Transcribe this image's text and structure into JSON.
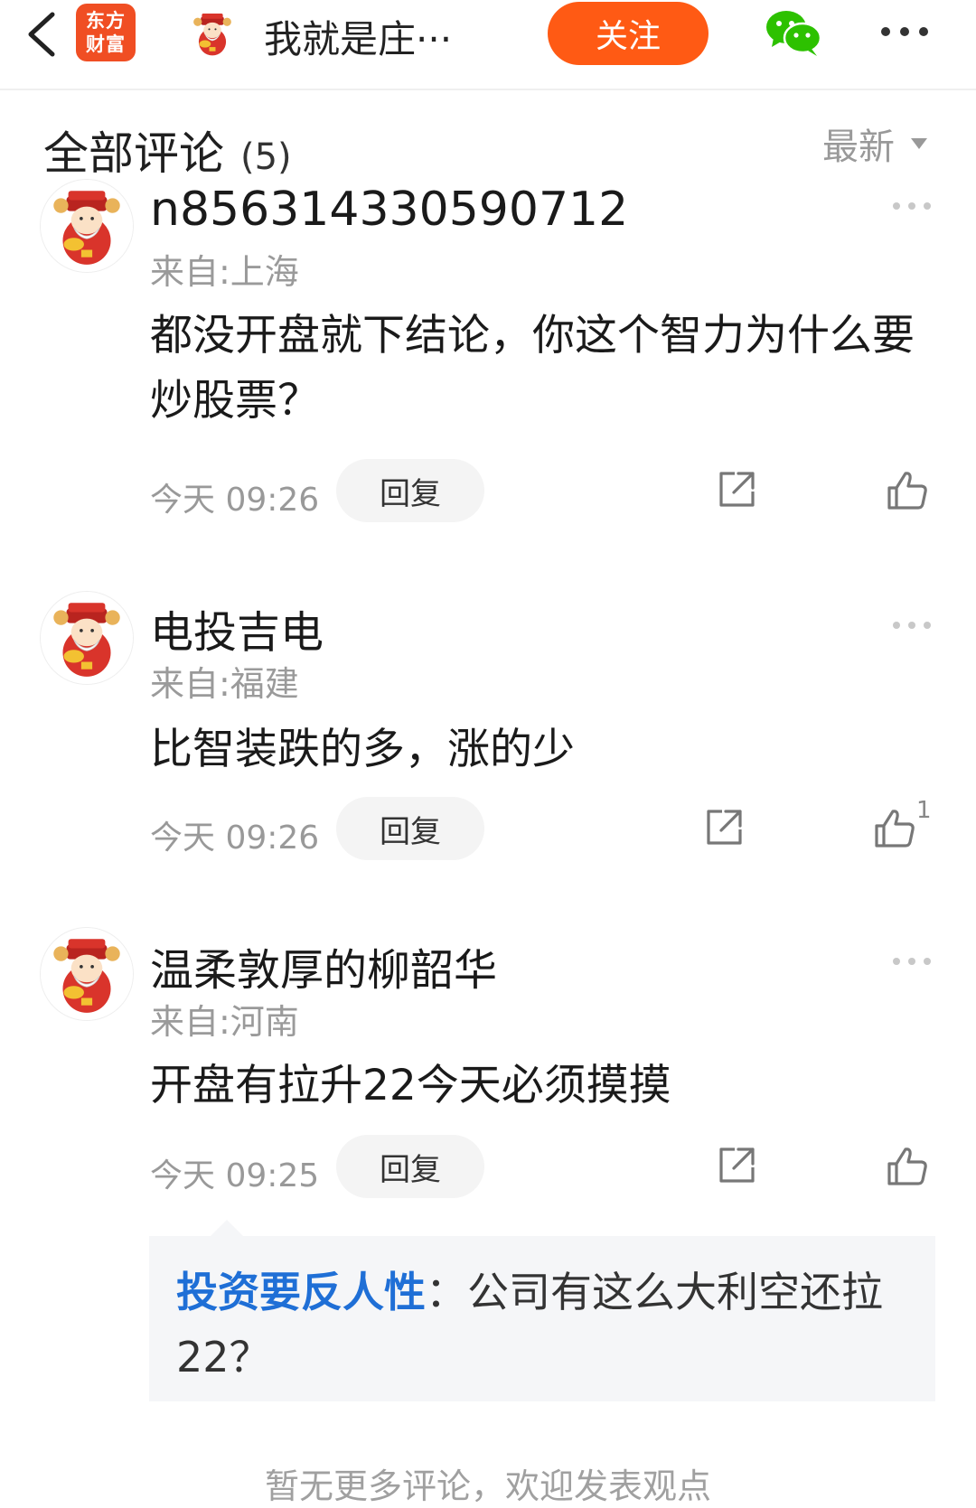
{
  "topbar": {
    "app_logo_line1": "东方",
    "app_logo_line2": "财富",
    "title": "我就是庄···",
    "follow_label": "关注"
  },
  "section": {
    "title": "全部评论",
    "count": "(5)",
    "sort_label": "最新"
  },
  "comments": [
    {
      "name": "n856314330590712",
      "location": "来自:上海",
      "text": "都没开盘就下结论，你这个智力为什么要炒股票？",
      "time": "今天 09:26",
      "reply_label": "回复",
      "likes": ""
    },
    {
      "name": "电投吉电",
      "location": "来自:福建",
      "text": "比智装跌的多，涨的少",
      "time": "今天 09:26",
      "reply_label": "回复",
      "likes": "1"
    },
    {
      "name": "温柔敦厚的柳韶华",
      "location": "来自:河南",
      "text": "开盘有拉升22今天必须摸摸",
      "time": "今天 09:25",
      "reply_label": "回复",
      "likes": ""
    }
  ],
  "subreply": {
    "author": "投资要反人性",
    "text": "：公司有这么大利空还拉22？"
  },
  "footer_text": "暂无更多评论，欢迎发表观点",
  "colors": {
    "accent": "#ff5a14",
    "logo": "#f04e23",
    "link": "#1f6fd6",
    "wechat": "#2dc100"
  }
}
